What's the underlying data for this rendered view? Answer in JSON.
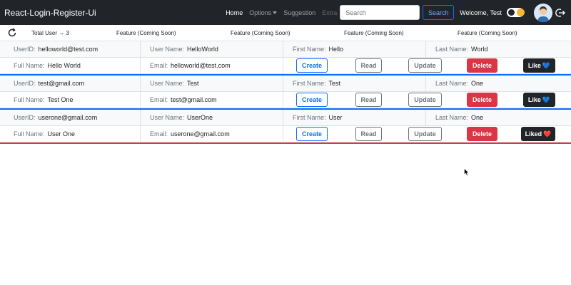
{
  "navbar": {
    "brand": "React-Login-Register-Ui",
    "links": {
      "home": "Home",
      "options": "Options",
      "suggestion": "Suggestion",
      "extra": "Extra"
    },
    "search_placeholder": "Search",
    "search_button": "Search",
    "welcome": "Welcome, Test"
  },
  "subheader": {
    "total_user": "Total User → 3",
    "features": [
      "Feature (Coming Soon)",
      "Feature (Coming Soon)",
      "Feature (Coming Soon)",
      "Feature (Coming Soon)"
    ]
  },
  "labels": {
    "user_id": "UserID:",
    "user_name": "User Name:",
    "first_name": "First Name:",
    "last_name": "Last Name:",
    "full_name": "Full Name:",
    "email": "Email:"
  },
  "buttons": {
    "create": "Create",
    "read": "Read",
    "update": "Update",
    "delete": "Delete",
    "like": "Like",
    "liked": "Liked"
  },
  "users": [
    {
      "user_id": "helloworld@test.com",
      "user_name": "HelloWorld",
      "first_name": "Hello",
      "last_name": "World",
      "full_name": "Hello World",
      "email": "helloworld@test.com",
      "like_label": "Like",
      "heart": "💙"
    },
    {
      "user_id": "test@gmail.com",
      "user_name": "Test",
      "first_name": "Test",
      "last_name": "One",
      "full_name": "Test One",
      "email": "test@gmail.com",
      "like_label": "Like",
      "heart": "💙"
    },
    {
      "user_id": "userone@gmail.com",
      "user_name": "UserOne",
      "first_name": "User",
      "last_name": "One",
      "full_name": "User One",
      "email": "userone@gmail.com",
      "like_label": "Liked",
      "heart": "❤️"
    }
  ],
  "colors": {
    "navbar_bg": "#212529",
    "primary": "#0d6efd",
    "danger": "#dc3545",
    "secondary": "#6c757d"
  }
}
